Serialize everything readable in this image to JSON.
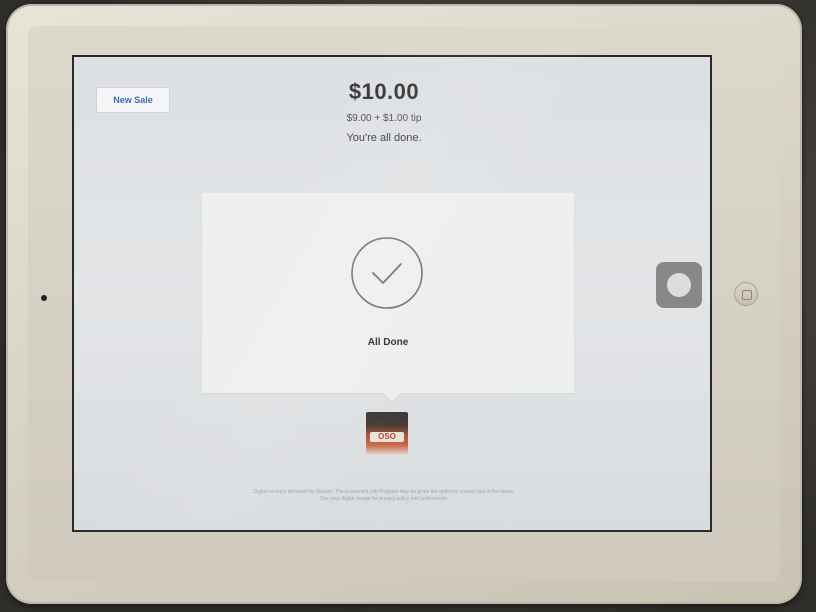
{
  "receipt": {
    "new_sale_label": "New Sale",
    "total": "$10.00",
    "breakdown": "$9.00 + $1.00 tip",
    "message": "You're all done."
  },
  "status_card": {
    "icon": "checkmark-circle-icon",
    "label": "All Done"
  },
  "product": {
    "thumbnail_label": "OSO"
  },
  "footer": {
    "fineprint_line1": "Digital receipts delivered by Square. The Economist Lite Program may be given the option to contact you in the future.",
    "fineprint_line2": "See your digital receipt for privacy policy and preferences."
  },
  "colors": {
    "accent": "#3b6fb6",
    "screen_bg": "#e0e2e5",
    "card_bg": "#eeefef"
  }
}
